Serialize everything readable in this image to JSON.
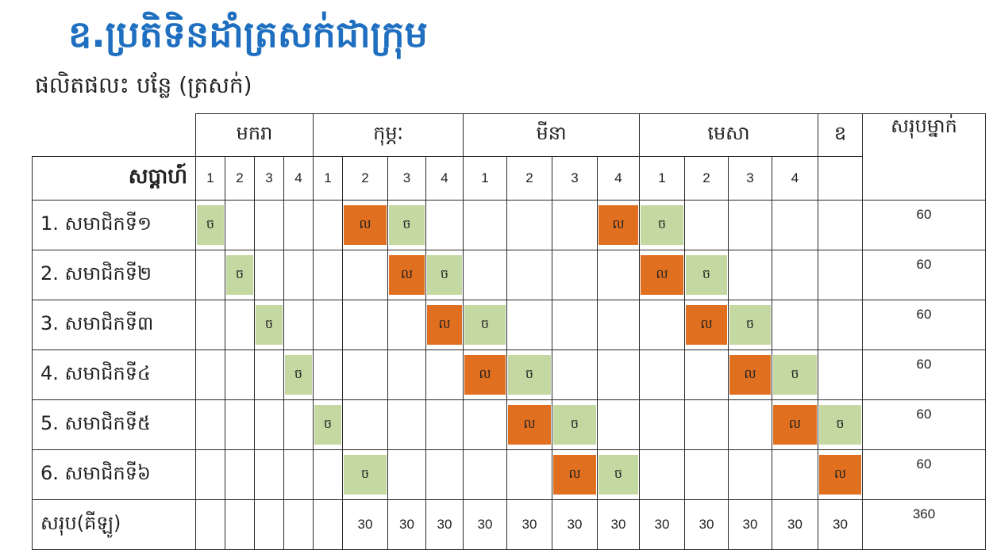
{
  "title": "ឧ.ប្រតិទិនដាំត្រសក់ជាក្រុម",
  "subtitle": "ផលិតផលះ បន្លែ (ត្រសក់)",
  "table": {
    "week_label": "សប្តាហ៍",
    "total_label": "សរុបម្នាក់",
    "months": [
      {
        "name": "មករា",
        "span": 4
      },
      {
        "name": "កុម្ភៈ",
        "span": 4
      },
      {
        "name": "មីនា",
        "span": 4
      },
      {
        "name": "មេសា",
        "span": 4
      },
      {
        "name": "ឧ",
        "span": 1
      }
    ],
    "weeks": [
      "1",
      "2",
      "3",
      "4",
      "1",
      "2",
      "3",
      "4",
      "1",
      "2",
      "3",
      "4",
      "1",
      "2",
      "3",
      "4",
      ""
    ],
    "plant_mark": "ច",
    "harvest_mark": "ល",
    "colors": {
      "plant": "#c4d9a2",
      "harvest": "#e07020"
    },
    "rows": [
      {
        "label": "1. សមាជិកទី១",
        "cells": [
          "ច",
          "",
          "",
          "",
          "",
          "ល",
          "ច",
          "",
          "",
          "",
          "",
          "ល",
          "ច",
          "",
          "",
          "",
          ""
        ],
        "total": "60"
      },
      {
        "label": "2. សមាជិកទី២",
        "cells": [
          "",
          "ច",
          "",
          "",
          "",
          "",
          "ល",
          "ច",
          "",
          "",
          "",
          "",
          "ល",
          "ច",
          "",
          "",
          ""
        ],
        "total": "60"
      },
      {
        "label": "3. សមាជិកទី៣",
        "cells": [
          "",
          "",
          "ច",
          "",
          "",
          "",
          "",
          "ល",
          "ច",
          "",
          "",
          "",
          "",
          "ល",
          "ច",
          "",
          ""
        ],
        "total": "60"
      },
      {
        "label": "4. សមាជិកទី៤",
        "cells": [
          "",
          "",
          "",
          "ច",
          "",
          "",
          "",
          "",
          "ល",
          "ច",
          "",
          "",
          "",
          "",
          "ល",
          "ច",
          ""
        ],
        "total": "60"
      },
      {
        "label": "5. សមាជិកទី៥",
        "cells": [
          "",
          "",
          "",
          "",
          "ច",
          "",
          "",
          "",
          "",
          "ល",
          "ច",
          "",
          "",
          "",
          "",
          "ល",
          "ច"
        ],
        "total": "60"
      },
      {
        "label": "6. សមាជិកទី៦",
        "cells": [
          "",
          "",
          "",
          "",
          "",
          "ច",
          "",
          "",
          "",
          "",
          "ល",
          "ច",
          "",
          "",
          "",
          "",
          "ល"
        ],
        "total": "60"
      }
    ],
    "sum_row": {
      "label": "សរុប(គីឡូ)",
      "cells": [
        "",
        "",
        "",
        "",
        "",
        "30",
        "30",
        "30",
        "30",
        "30",
        "30",
        "30",
        "30",
        "30",
        "30",
        "30",
        "30"
      ],
      "total": "360"
    }
  }
}
